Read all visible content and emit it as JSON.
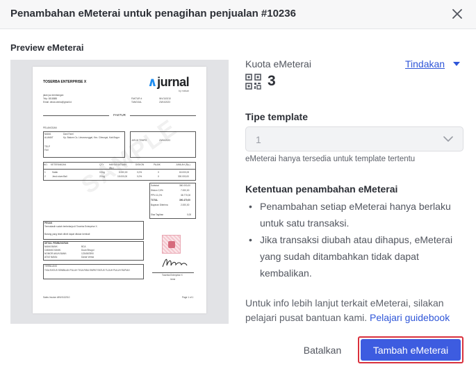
{
  "dialog": {
    "title": "Penambahan eMeterai untuk penagihan penjualan #10236"
  },
  "preview": {
    "label": "Preview eMeterai",
    "document": {
      "company": "TOSERBA ENTERPRISE X",
      "brand": "jurnal",
      "brand_sub": "by mekari",
      "address_lines": [
        "jalan jua kembangan",
        "Telp. 0818888",
        "Email: dewa.sekira@gmail.id"
      ],
      "meta_labels": [
        "FAKTUR #",
        "TANGGAL"
      ],
      "meta_values": [
        "INV/10/2/10",
        "23/04/2023"
      ],
      "faktur_heading": "FAKTUR",
      "pelanggan_label": "PELANGGAN",
      "customer_labels": [
        "NAMA",
        "ALAMAT",
        "TELP",
        "FAX"
      ],
      "customer_values": [
        "Dani Farel",
        "Kp. Bakom Cs. Limusnunggal, Kec. Cileungsi, Kab.Bogor",
        "",
        ""
      ],
      "jatuh_tempo_label": "JATUH TEMPO",
      "jatuh_tempo_value": "23/06/2023",
      "table_headers": [
        "NO.",
        "KETERANGAN",
        "QTY",
        "HARGA SATUAN (Rp.)",
        "DISKON",
        "PAJAK",
        "JUMLAH (Rp.)"
      ],
      "table_rows": [
        [
          "1",
          "Salak",
          "10 kg",
          "6.000,00",
          "0,0%",
          "X",
          "60.000,00"
        ],
        [
          "2",
          "Jeruk siam Bali",
          "20 kg",
          "15.000,00",
          "0,0%",
          "X",
          "300.000,00"
        ]
      ],
      "totals_labels": [
        "Subtotal",
        "Diskon 2,5%",
        "PPN 11,0%",
        "TOTAL",
        "Bayaran Diterima",
        "Sisa Tagihan"
      ],
      "totals_values": [
        "360.000,00",
        "7.000,00",
        "38.770,00",
        "390.470,00",
        "2.000,00",
        "0,00"
      ],
      "pesan_label": "PESAN",
      "pesan_lines": [
        "Termakasih sudah berbelanja di Toserba Enterprise X.",
        "Barang yang telah dibeli dapat ditukar kembali"
      ],
      "bank_label": "DETAIL PEMBAYARAN",
      "bank_labels": [
        "NAMA BANK:",
        "CABANG BANK:",
        "NOMOR AKUN BANK:",
        "ATAS NAMA:"
      ],
      "bank_values": [
        "BCA",
        "Duan Bhugol",
        "1234567890",
        "Dania Vetnia"
      ],
      "terbilang_label": "TERBILANG",
      "terbilang_text": "TIGA RATUS SEMBILAN PULUH TIGA RIBU EMPAT RATUS TUJUH PULUH RUPIAH",
      "signer": "Toserba Enterprise X",
      "signer_sub": "Irene",
      "footer_left": "Sales Invoice #INV/10/2/10",
      "footer_right": "Page 1 of 1",
      "watermark": "SAMPLE"
    }
  },
  "kuota": {
    "label": "Kuota eMeterai",
    "value": "3",
    "action_label": "Tindakan"
  },
  "template": {
    "label": "Tipe template",
    "selected": "1",
    "hint": "eMeterai hanya tersedia untuk template tertentu"
  },
  "ketentuan": {
    "title": "Ketentuan penambahan eMeterai",
    "items": [
      "Penambahan setiap eMeterai hanya berlaku untuk satu transaksi.",
      "Jika transaksi diubah atau dihapus, eMeterai yang sudah ditambahkan tidak dapat kembalikan."
    ]
  },
  "info": {
    "text": "Untuk info lebih lanjut terkait eMeterai, silakan pelajari pusat bantuan kami.",
    "link": "Pelajari guidebook"
  },
  "footer": {
    "cancel_label": "Batalkan",
    "submit_label": "Tambah eMeterai"
  },
  "colors": {
    "primary": "#3d5ce0",
    "link": "#2f56d8",
    "highlight_border": "#d9303d",
    "header_bg": "#f7f7f8",
    "preview_bg": "#e2e3e6"
  }
}
